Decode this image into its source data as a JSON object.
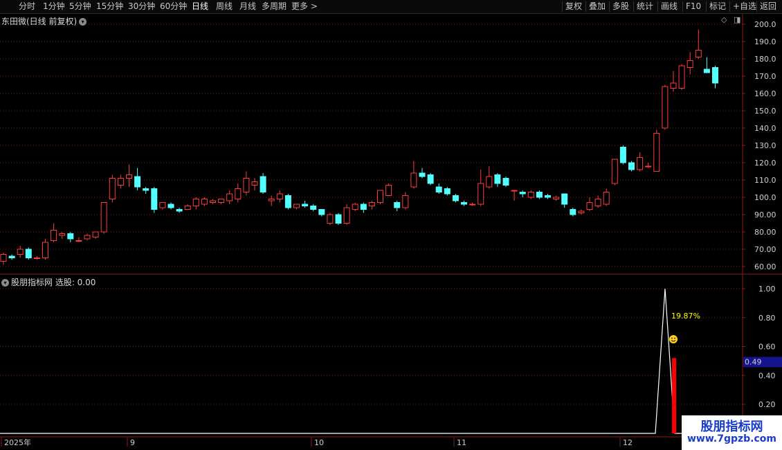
{
  "toolbar": {
    "left": [
      "分时",
      "1分钟",
      "5分钟",
      "15分钟",
      "30分钟",
      "60分钟",
      "日线",
      "周线",
      "月线",
      "多周期",
      "更多 >"
    ],
    "right": [
      "复权",
      "叠加",
      "多股",
      "统计",
      "画线",
      "F10",
      "标记",
      "+自选",
      "返回"
    ],
    "active": "日线"
  },
  "main_panel": {
    "title": "东田微(日线 前复权)",
    "y_ticks": [
      "200.0",
      "190.0",
      "180.0",
      "170.0",
      "160.0",
      "150.0",
      "140.0",
      "130.0",
      "120.0",
      "110.0",
      "100.0",
      "90.00",
      "80.00",
      "70.00",
      "60.00"
    ]
  },
  "indicator_panel": {
    "title": "股朋指标网  选股: 0.00",
    "y_ticks": [
      "1.00",
      "0.80",
      "0.60",
      "0.40",
      "0.20"
    ],
    "current_value": "0.49",
    "annotation": "19.87%"
  },
  "x_axis": {
    "labels": [
      "2025年",
      "9",
      "10",
      "11",
      "12"
    ]
  },
  "watermark": {
    "name": "股朋指标网",
    "url": "www.7gpzb.com"
  },
  "colors": {
    "up": "#ff3c3c",
    "down": "#54ffff",
    "grid": "#8b1a1a",
    "signal": "#ff0000",
    "line": "#ffffff",
    "annot": "#ffff00"
  },
  "chart_data": {
    "type": "candlestick",
    "y_range": [
      55,
      205
    ],
    "candles": [
      {
        "o": 63,
        "h": 68,
        "l": 61,
        "c": 67
      },
      {
        "o": 66,
        "h": 67,
        "l": 64,
        "c": 65
      },
      {
        "o": 67,
        "h": 72,
        "l": 65,
        "c": 70
      },
      {
        "o": 70,
        "h": 71,
        "l": 64,
        "c": 65
      },
      {
        "o": 65,
        "h": 66,
        "l": 64,
        "c": 65
      },
      {
        "o": 65,
        "h": 76,
        "l": 64,
        "c": 74
      },
      {
        "o": 75,
        "h": 85,
        "l": 74,
        "c": 81
      },
      {
        "o": 78,
        "h": 80,
        "l": 76,
        "c": 79
      },
      {
        "o": 79,
        "h": 80,
        "l": 74,
        "c": 76
      },
      {
        "o": 75,
        "h": 77,
        "l": 74,
        "c": 75
      },
      {
        "o": 76,
        "h": 79,
        "l": 75,
        "c": 78
      },
      {
        "o": 77,
        "h": 80,
        "l": 76,
        "c": 80
      },
      {
        "o": 80,
        "h": 97,
        "l": 79,
        "c": 97
      },
      {
        "o": 99,
        "h": 113,
        "l": 97,
        "c": 111
      },
      {
        "o": 107,
        "h": 113,
        "l": 105,
        "c": 111
      },
      {
        "o": 111,
        "h": 119,
        "l": 106,
        "c": 113
      },
      {
        "o": 112,
        "h": 117,
        "l": 104,
        "c": 106
      },
      {
        "o": 105,
        "h": 106,
        "l": 102,
        "c": 104
      },
      {
        "o": 105,
        "h": 106,
        "l": 91,
        "c": 93
      },
      {
        "o": 94,
        "h": 97,
        "l": 93,
        "c": 97
      },
      {
        "o": 96,
        "h": 97,
        "l": 93,
        "c": 94
      },
      {
        "o": 93,
        "h": 94,
        "l": 91,
        "c": 92
      },
      {
        "o": 93,
        "h": 96,
        "l": 93,
        "c": 95
      },
      {
        "o": 95,
        "h": 100,
        "l": 93,
        "c": 99
      },
      {
        "o": 96,
        "h": 100,
        "l": 95,
        "c": 99
      },
      {
        "o": 97,
        "h": 99,
        "l": 96,
        "c": 98
      },
      {
        "o": 97,
        "h": 99,
        "l": 96,
        "c": 99
      },
      {
        "o": 98,
        "h": 104,
        "l": 96,
        "c": 102
      },
      {
        "o": 99,
        "h": 108,
        "l": 97,
        "c": 105
      },
      {
        "o": 103,
        "h": 115,
        "l": 101,
        "c": 111
      },
      {
        "o": 107,
        "h": 111,
        "l": 104,
        "c": 109
      },
      {
        "o": 112,
        "h": 114,
        "l": 102,
        "c": 103
      },
      {
        "o": 98,
        "h": 101,
        "l": 95,
        "c": 99
      },
      {
        "o": 99,
        "h": 104,
        "l": 97,
        "c": 102
      },
      {
        "o": 101,
        "h": 102,
        "l": 93,
        "c": 94
      },
      {
        "o": 94,
        "h": 96,
        "l": 93,
        "c": 96
      },
      {
        "o": 96,
        "h": 98,
        "l": 94,
        "c": 95
      },
      {
        "o": 95,
        "h": 96,
        "l": 92,
        "c": 93
      },
      {
        "o": 93,
        "h": 93,
        "l": 89,
        "c": 90
      },
      {
        "o": 85,
        "h": 91,
        "l": 84,
        "c": 90
      },
      {
        "o": 90,
        "h": 91,
        "l": 84,
        "c": 85
      },
      {
        "o": 85,
        "h": 96,
        "l": 84,
        "c": 94
      },
      {
        "o": 93,
        "h": 97,
        "l": 92,
        "c": 96
      },
      {
        "o": 96,
        "h": 97,
        "l": 91,
        "c": 93
      },
      {
        "o": 95,
        "h": 98,
        "l": 93,
        "c": 97
      },
      {
        "o": 97,
        "h": 104,
        "l": 96,
        "c": 104
      },
      {
        "o": 101,
        "h": 108,
        "l": 101,
        "c": 107
      },
      {
        "o": 97,
        "h": 98,
        "l": 92,
        "c": 94
      },
      {
        "o": 94,
        "h": 103,
        "l": 93,
        "c": 101
      },
      {
        "o": 106,
        "h": 121,
        "l": 105,
        "c": 114
      },
      {
        "o": 114,
        "h": 117,
        "l": 111,
        "c": 112
      },
      {
        "o": 113,
        "h": 114,
        "l": 107,
        "c": 108
      },
      {
        "o": 106,
        "h": 108,
        "l": 102,
        "c": 103
      },
      {
        "o": 105,
        "h": 106,
        "l": 101,
        "c": 102
      },
      {
        "o": 101,
        "h": 102,
        "l": 97,
        "c": 98
      },
      {
        "o": 97,
        "h": 98,
        "l": 95,
        "c": 96
      },
      {
        "o": 96,
        "h": 97,
        "l": 95,
        "c": 96
      },
      {
        "o": 96,
        "h": 116,
        "l": 95,
        "c": 108
      },
      {
        "o": 106,
        "h": 118,
        "l": 105,
        "c": 112
      },
      {
        "o": 113,
        "h": 114,
        "l": 106,
        "c": 108
      },
      {
        "o": 111,
        "h": 112,
        "l": 106,
        "c": 107
      },
      {
        "o": 104,
        "h": 104,
        "l": 98,
        "c": 104
      },
      {
        "o": 103,
        "h": 104,
        "l": 100,
        "c": 102
      },
      {
        "o": 100,
        "h": 104,
        "l": 99,
        "c": 103
      },
      {
        "o": 103,
        "h": 104,
        "l": 99,
        "c": 100
      },
      {
        "o": 101,
        "h": 102,
        "l": 99,
        "c": 100
      },
      {
        "o": 99,
        "h": 101,
        "l": 98,
        "c": 100
      },
      {
        "o": 102,
        "h": 102,
        "l": 94,
        "c": 96
      },
      {
        "o": 93,
        "h": 94,
        "l": 89,
        "c": 90
      },
      {
        "o": 91,
        "h": 93,
        "l": 90,
        "c": 92
      },
      {
        "o": 93,
        "h": 100,
        "l": 92,
        "c": 97
      },
      {
        "o": 95,
        "h": 101,
        "l": 94,
        "c": 99
      },
      {
        "o": 96,
        "h": 105,
        "l": 95,
        "c": 103
      },
      {
        "o": 108,
        "h": 122,
        "l": 107,
        "c": 122
      },
      {
        "o": 129,
        "h": 130,
        "l": 119,
        "c": 120
      },
      {
        "o": 120,
        "h": 121,
        "l": 115,
        "c": 116
      },
      {
        "o": 116,
        "h": 126,
        "l": 115,
        "c": 123
      },
      {
        "o": 118,
        "h": 120,
        "l": 117,
        "c": 118
      },
      {
        "o": 115,
        "h": 139,
        "l": 115,
        "c": 137
      },
      {
        "o": 140,
        "h": 165,
        "l": 139,
        "c": 164
      },
      {
        "o": 163,
        "h": 173,
        "l": 161,
        "c": 166
      },
      {
        "o": 163,
        "h": 177,
        "l": 162,
        "c": 176
      },
      {
        "o": 175,
        "h": 184,
        "l": 171,
        "c": 179
      },
      {
        "o": 181,
        "h": 197,
        "l": 180,
        "c": 185
      },
      {
        "o": 174,
        "h": 181,
        "l": 172,
        "c": 172
      },
      {
        "o": 175,
        "h": 176,
        "l": 163,
        "c": 166
      }
    ],
    "indicator": {
      "y_range": [
        0.1,
        1.05
      ],
      "line_peak_index": 80,
      "line_peak_value": 1.0,
      "bar_index": 81,
      "bar_value": 0.52
    }
  }
}
